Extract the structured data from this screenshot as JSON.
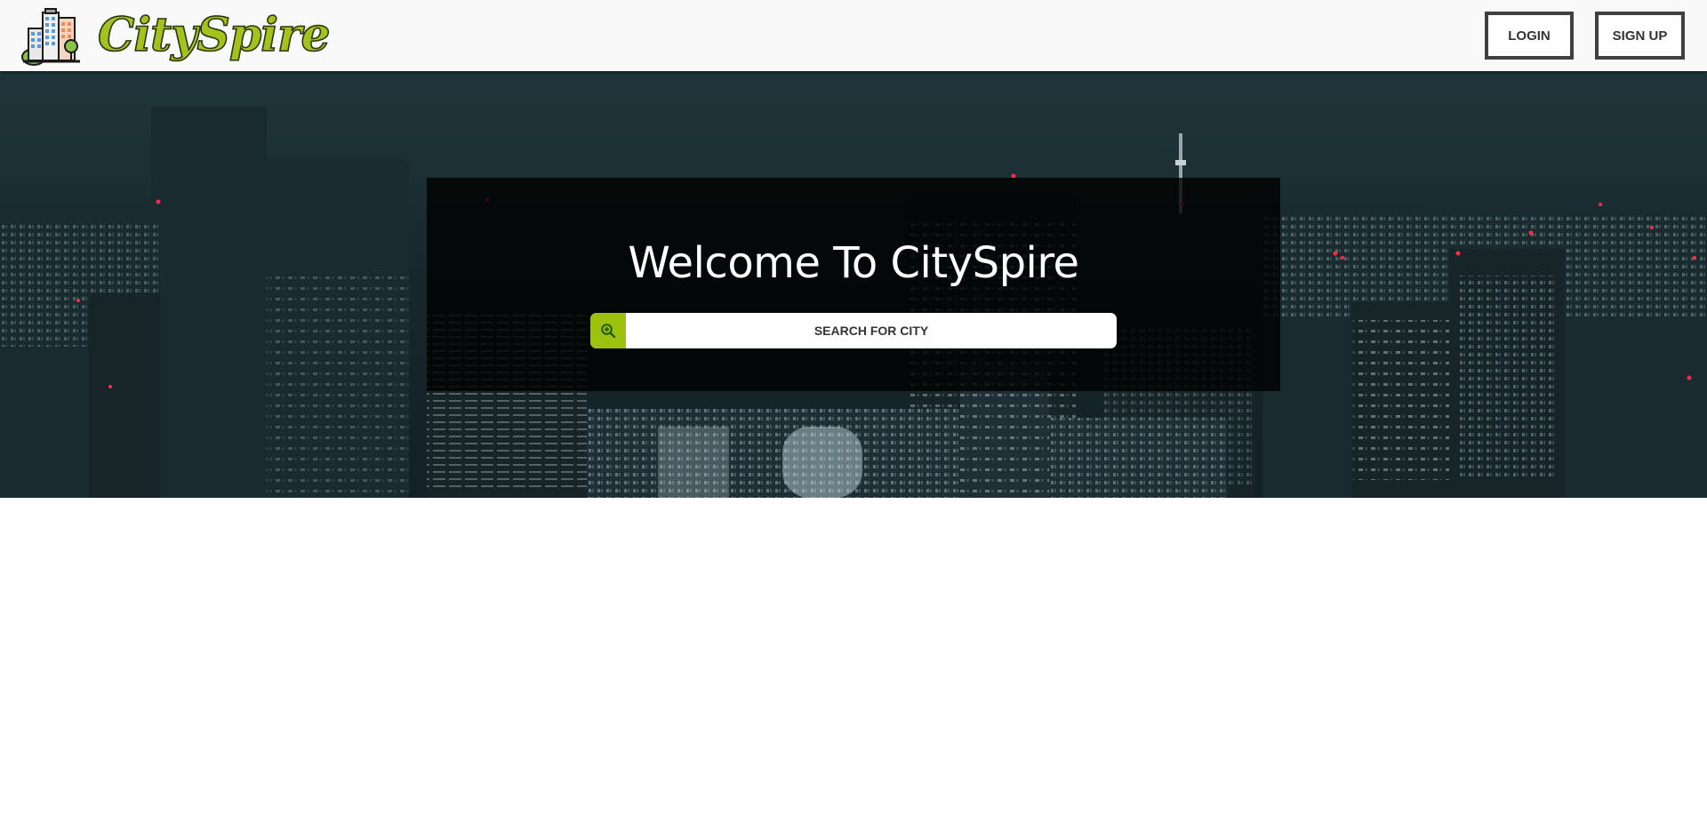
{
  "header": {
    "logo_text": "CitySpire",
    "logo_icon": "city-buildings-icon",
    "login_label": "LOGIN",
    "signup_label": "SIGN UP"
  },
  "hero": {
    "title": "Welcome To CitySpire",
    "search": {
      "placeholder": "SEARCH FOR CITY",
      "value": "",
      "icon": "zoom-in-icon"
    }
  },
  "colors": {
    "brand_green": "#a3c21b",
    "search_button": "#9cc10f",
    "header_bg": "#f9f9f9",
    "button_border": "#404040"
  }
}
